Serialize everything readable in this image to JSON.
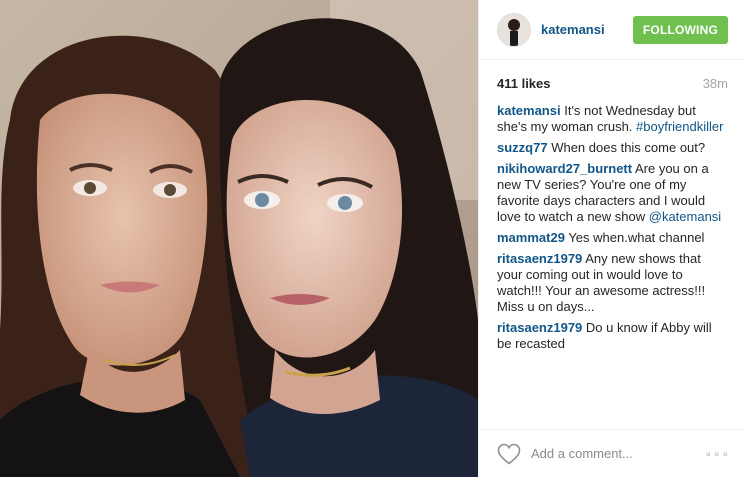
{
  "post": {
    "username": "katemansi",
    "follow_label": "FOLLOWING",
    "likes": "411 likes",
    "time": "38m",
    "photo_icon": "photo-of-two-women-selfie"
  },
  "comments": [
    {
      "user": "katemansi",
      "text": "It's not Wednesday but she's my woman crush. ",
      "tag": "#boyfriendkiller"
    },
    {
      "user": "suzzq77",
      "text": "When does this come out?",
      "tag": ""
    },
    {
      "user": "nikihoward27_burnett",
      "text": "Are you on a new TV series? You're one of my favorite days characters and I would love to watch a new show ",
      "tag": "@katemansi"
    },
    {
      "user": "mammat29",
      "text": "Yes when.what channel",
      "tag": ""
    },
    {
      "user": "ritasaenz1979",
      "text": "Any new shows that your coming out in would love to watch!!! Your an awesome actress!!! Miss u on days...",
      "tag": ""
    },
    {
      "user": "ritasaenz1979",
      "text": "Do u know if Abby will be recasted",
      "tag": ""
    }
  ],
  "footer": {
    "comment_placeholder": "Add a comment...",
    "more": "∘∘∘",
    "heart_icon": "heart-icon"
  },
  "colors": {
    "username": "#125688",
    "follow": "#70c050",
    "muted": "#a5a7aa"
  }
}
